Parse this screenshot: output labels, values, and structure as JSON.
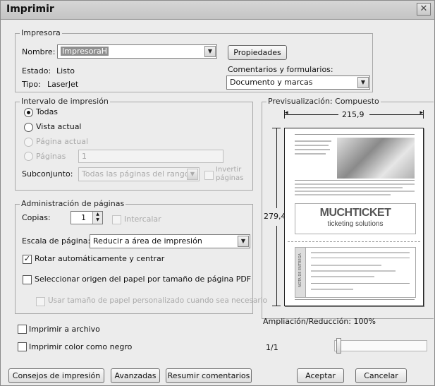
{
  "window": {
    "title": "Imprimir",
    "close_symbol": "✕"
  },
  "printer": {
    "legend": "Impresora",
    "name_label": "Nombre:",
    "name_value": "ImpresoraH",
    "properties_button": "Propiedades",
    "status_label": "Estado:",
    "status_value": "Listo",
    "type_label": "Tipo:",
    "type_value": "LaserJet",
    "comments_label": "Comentarios y formularios:",
    "comments_value": "Documento y marcas"
  },
  "range": {
    "legend": "Intervalo de impresión",
    "all": "Todas",
    "current_view": "Vista actual",
    "current_page": "Página actual",
    "pages": "Páginas",
    "pages_value": "1",
    "subset_label": "Subconjunto:",
    "subset_value": "Todas las páginas del rango",
    "invert_line1": "Invertir",
    "invert_line2": "páginas"
  },
  "handling": {
    "legend": "Administración de páginas",
    "copies_label": "Copias:",
    "copies_value": "1",
    "collate": "Intercalar",
    "scale_label": "Escala de página:",
    "scale_value": "Reducir a área de impresión",
    "auto_rotate": "Rotar automáticamente y centrar",
    "choose_source": "Seleccionar origen del papel por tamaño de página PDF",
    "custom_paper": "Usar tamaño de papel personalizado cuando sea necesario"
  },
  "options": {
    "print_to_file": "Imprimir a archivo",
    "print_black": "Imprimir color como negro"
  },
  "preview": {
    "legend": "Previsualización: Compuesto",
    "width_dim": "215,9",
    "height_dim": "279,4",
    "zoom": "Ampliación/Reducción: 100%",
    "page_counter": "1/1",
    "doc_logo": "MUCHTICKET",
    "doc_tagline": "ticketing solutions",
    "doc_stub_label": "NOTA DE ENTREGA"
  },
  "footer": {
    "tips_button": "Consejos de impresión",
    "advanced_button": "Avanzadas",
    "summarize_button": "Resumir comentarios",
    "ok_button": "Aceptar",
    "cancel_button": "Cancelar"
  }
}
